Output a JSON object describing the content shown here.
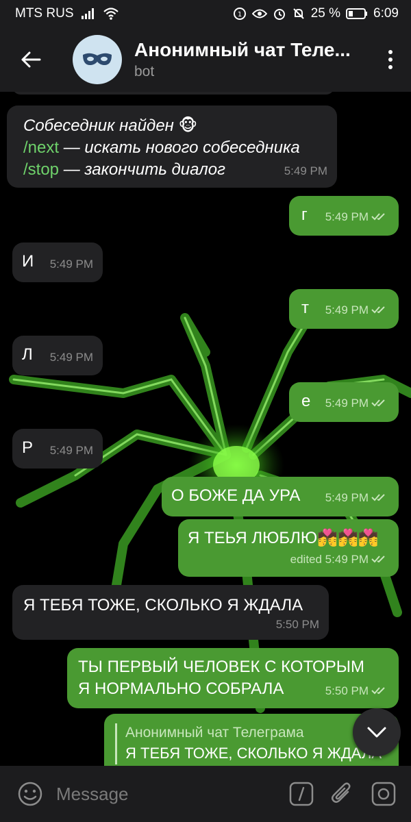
{
  "status_bar": {
    "carrier": "MTS RUS",
    "battery_percent": "25 %",
    "time": "6:09"
  },
  "header": {
    "title": "Анонимный чат Теле...",
    "subtitle": "bot",
    "avatar_icon": "mask-icon"
  },
  "messages": [
    {
      "dir": "in",
      "line1": "Собеседник найден 🐵",
      "cmd2": "/next",
      "rest2": " — искать нового собеседника",
      "cmd3": "/stop",
      "rest3": " — закончить диалог",
      "time": "5:49 PM"
    },
    {
      "dir": "out",
      "text": "г",
      "time": "5:49 PM"
    },
    {
      "dir": "in",
      "text": "И",
      "time": "5:49 PM"
    },
    {
      "dir": "out",
      "text": "т",
      "time": "5:49 PM"
    },
    {
      "dir": "in",
      "text": "Л",
      "time": "5:49 PM"
    },
    {
      "dir": "out",
      "text": "е",
      "time": "5:49 PM"
    },
    {
      "dir": "in",
      "text": "Р",
      "time": "5:49 PM"
    },
    {
      "dir": "out",
      "text": "О БОЖЕ ДА УРА",
      "time": "5:49 PM"
    },
    {
      "dir": "out",
      "text": "Я ТЕЬЯ ЛЮБЛЮ💏💏💏",
      "time": "edited 5:49 PM"
    },
    {
      "dir": "in",
      "text": "Я ТЕБЯ ТОЖЕ, СКОЛЬКО Я ЖДАЛА",
      "time": "5:50 PM"
    },
    {
      "dir": "out",
      "line1": "ТЫ ПЕРВЫЙ ЧЕЛОВЕК С КОТОРЫМ",
      "line2": "Я НОРМАЛЬНО СОБРАЛА",
      "time": "5:50 PM"
    },
    {
      "dir": "out",
      "reply_name": "Анонимный чат Телеграма",
      "reply_text": "Я ТЕБЯ ТОЖЕ, СКОЛЬКО Я ЖДАЛА"
    }
  ],
  "input": {
    "placeholder": "Message"
  },
  "colors": {
    "outgoing_bubble": "#4a9a32",
    "incoming_bubble": "#222224",
    "command_link": "#6fd26b",
    "bar_bg": "#1c1c1e"
  }
}
